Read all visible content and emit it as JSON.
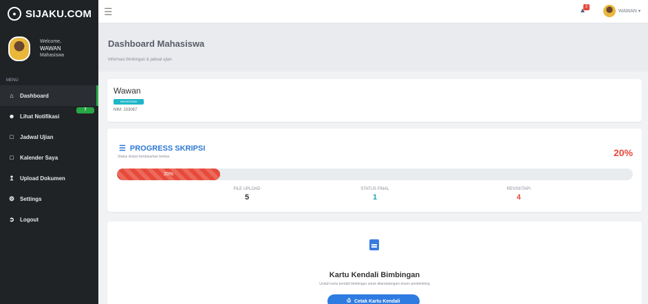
{
  "brand": {
    "name": "SIJAKU.COM",
    "logo_icon": "seal-icon"
  },
  "profile": {
    "welcome": "Welcome,",
    "name": "WAWAN",
    "role": "Mahasiswa"
  },
  "menu_label": "MENU",
  "sidebar": {
    "items": [
      {
        "label": "Dashboard",
        "icon": "home-icon",
        "active": true
      },
      {
        "label": "Lihat Notifikasi",
        "icon": "users-icon",
        "badge": "7"
      },
      {
        "label": "Jadwal Ujian",
        "icon": "calendar-icon"
      },
      {
        "label": "Kalender Saya",
        "icon": "calendar-icon"
      },
      {
        "label": "Upload Dokumen",
        "icon": "upload-icon"
      },
      {
        "label": "Settings",
        "icon": "gear-icon"
      },
      {
        "label": "Logout",
        "icon": "logout-icon"
      }
    ]
  },
  "topbar": {
    "notification_count": "2",
    "user_label": "WAWAN"
  },
  "page": {
    "title": "Dashboard Mahasiswa",
    "subtitle": "Informasi bimbingan & jadwal ujian"
  },
  "user_card": {
    "name": "Wawan",
    "tag": "MAHASISWA",
    "nim": "NIM: 103067"
  },
  "progress": {
    "title": "PROGRESS SKRIPSI",
    "subtitle": "Status skripsi berdasarkan berkas",
    "percent_text": "20%",
    "bar_label": "20%",
    "value": 0.2,
    "stats": [
      {
        "label": "FILE UPLOAD",
        "value": "5"
      },
      {
        "label": "STATUS FINAL",
        "value": "1"
      },
      {
        "label": "REVISI/TAPI",
        "value": "4"
      }
    ]
  },
  "kartu": {
    "title": "Kartu Kendali Bimbingan",
    "subtitle": "Unduh kartu kendali bimbingan untuk ditandatangani dosen pembimbing",
    "button": "Cetak Kartu Kendali"
  },
  "colors": {
    "accent": "#2e7be2",
    "danger": "#e74a3b",
    "success": "#28a745",
    "sidebar": "#1f2326"
  }
}
